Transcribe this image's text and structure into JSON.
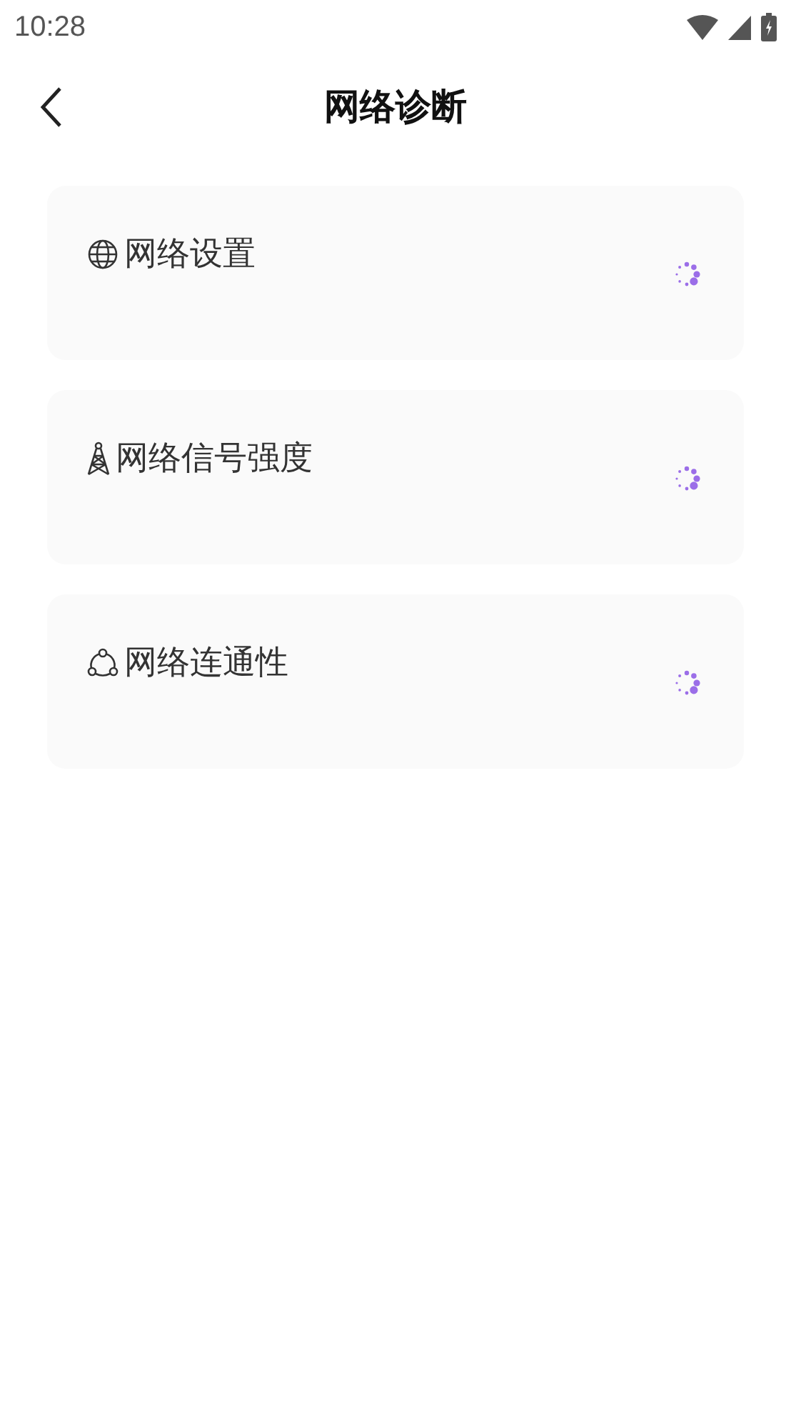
{
  "status_bar": {
    "time": "10:28"
  },
  "header": {
    "title": "网络诊断"
  },
  "checks": [
    {
      "kind": "globe",
      "label": "网络设置"
    },
    {
      "kind": "tower",
      "label": "网络信号强度"
    },
    {
      "kind": "nodes",
      "label": "网络连通性"
    }
  ]
}
